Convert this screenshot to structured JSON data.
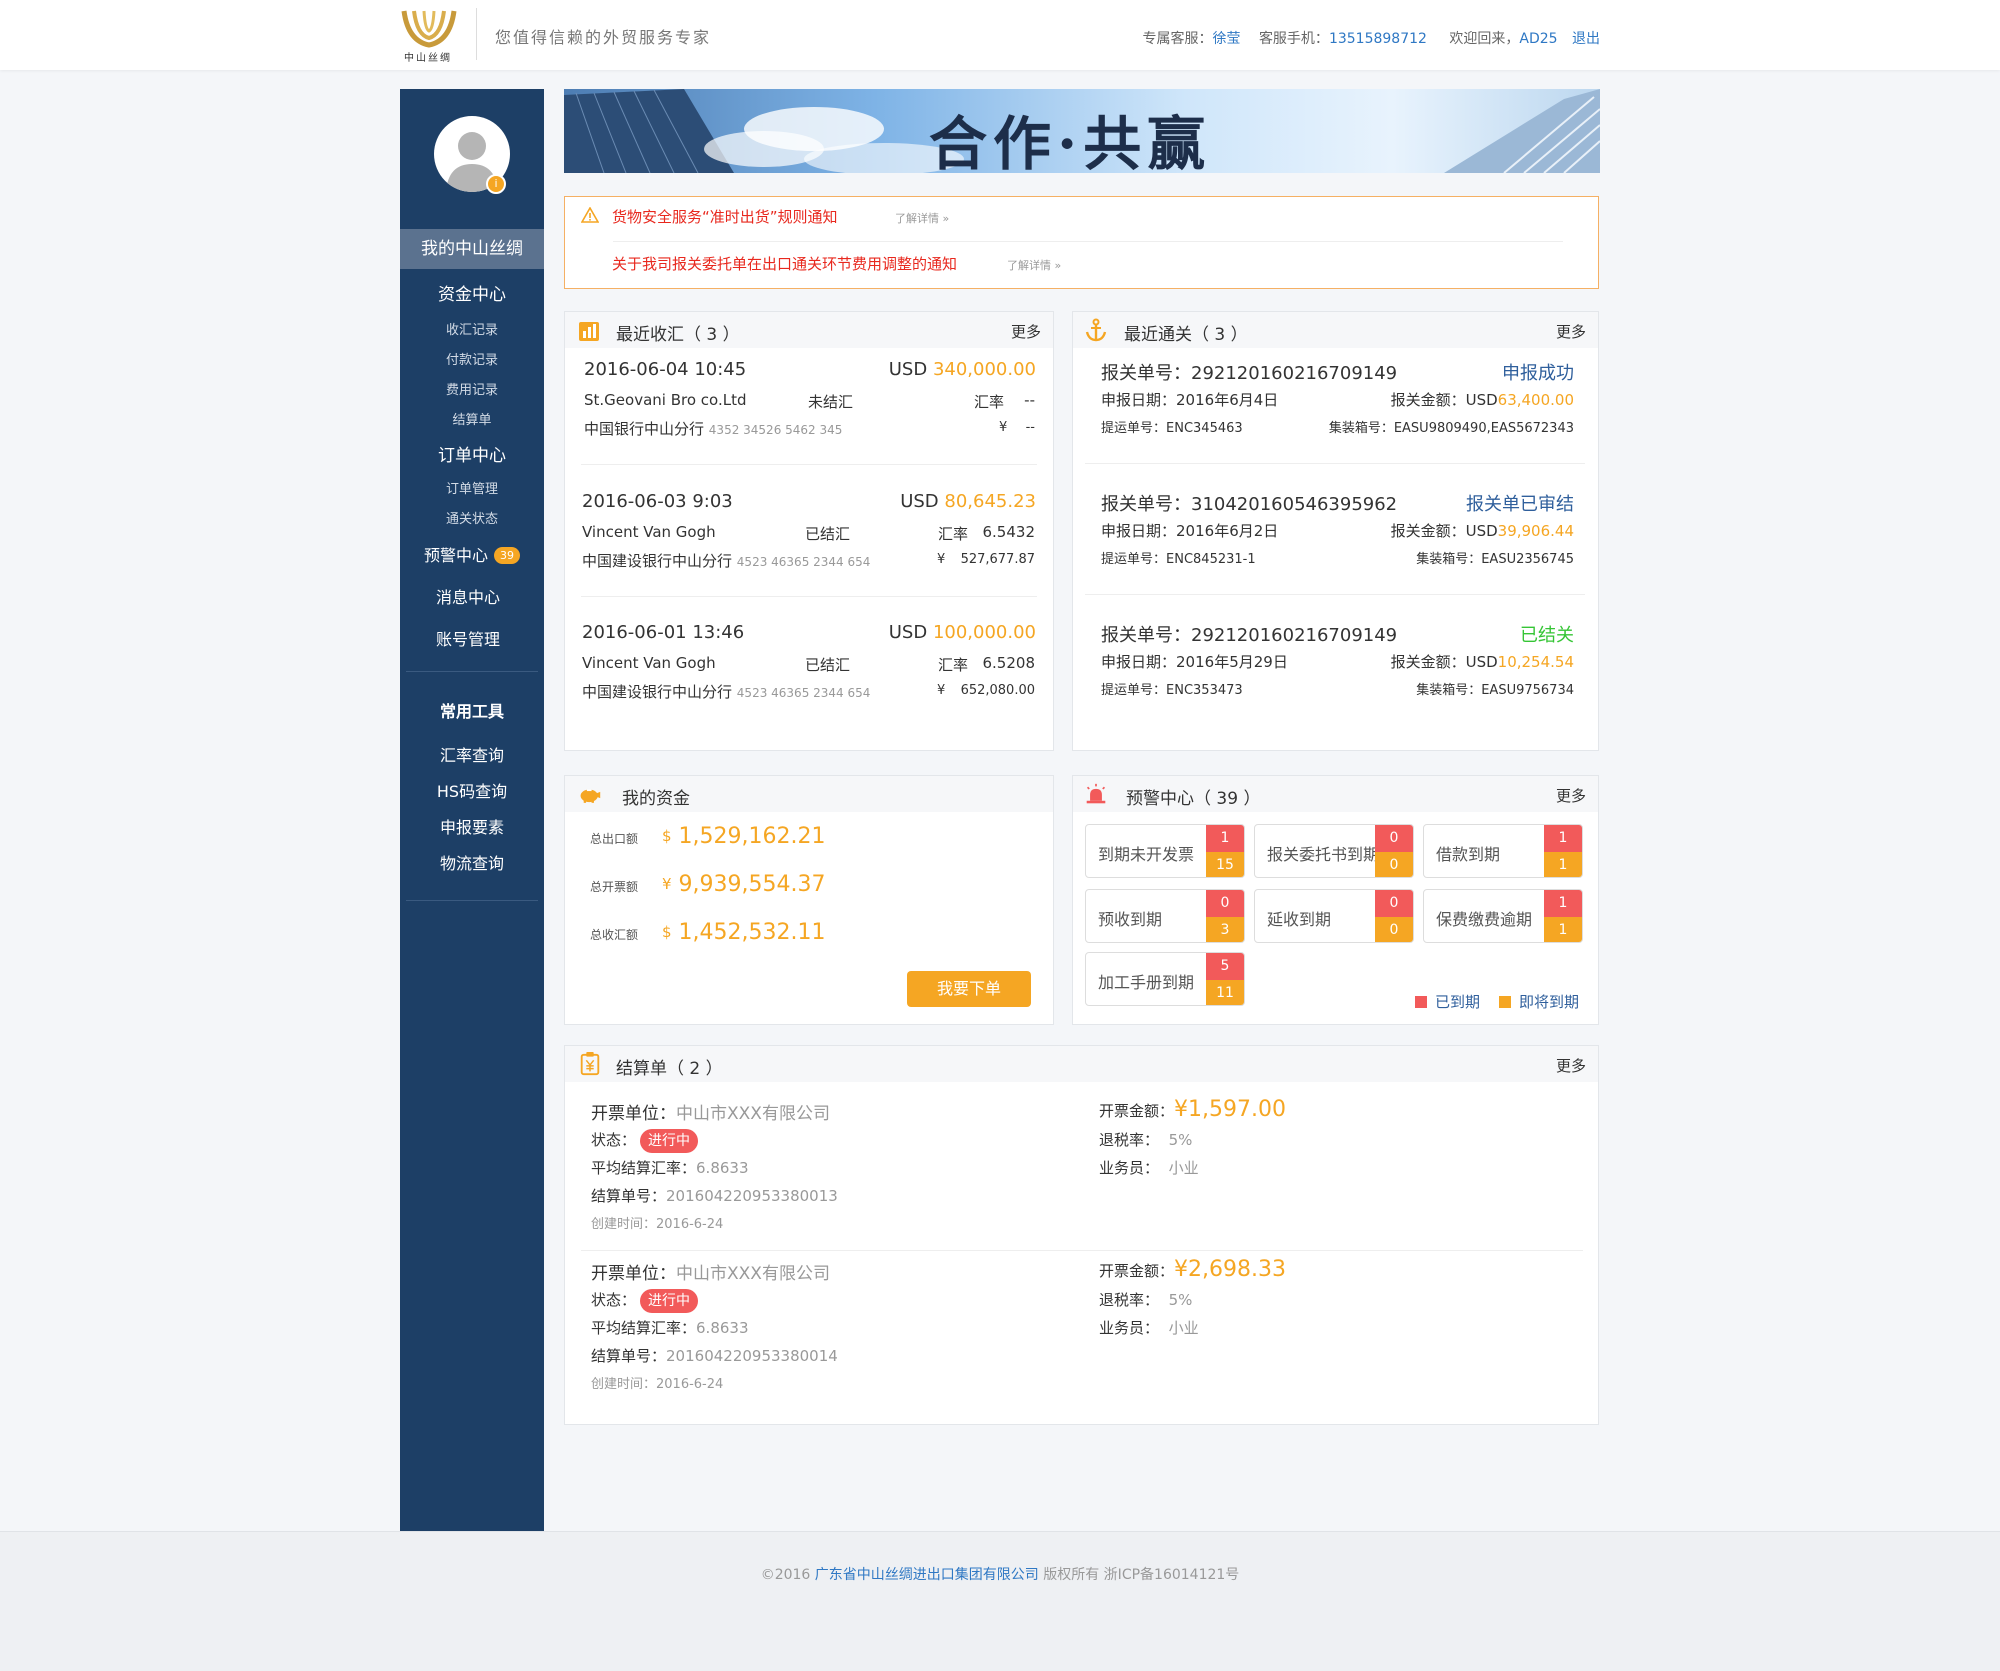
{
  "header": {
    "logo_text": "中山丝绸",
    "slogan": "您值得信赖的外贸服务专家",
    "service_label": "专属客服：",
    "service_name": "徐莹",
    "phone_label": "客服手机：",
    "phone": "13515898712",
    "welcome": "欢迎回来，",
    "username": "AD25",
    "logout": "退出"
  },
  "sidebar": {
    "items": [
      {
        "label": "我的中山丝绸"
      },
      {
        "label": "资金中心"
      },
      {
        "label": "收汇记录"
      },
      {
        "label": "付款记录"
      },
      {
        "label": "费用记录"
      },
      {
        "label": "结算单"
      },
      {
        "label": "订单中心"
      },
      {
        "label": "订单管理"
      },
      {
        "label": "通关状态"
      },
      {
        "label": "预警中心",
        "badge": "39"
      },
      {
        "label": "消息中心"
      },
      {
        "label": "账号管理"
      }
    ],
    "tools_title": "常用工具",
    "tools": [
      {
        "label": "汇率查询"
      },
      {
        "label": "HS码查询"
      },
      {
        "label": "申报要素"
      },
      {
        "label": "物流查询"
      }
    ]
  },
  "banner": {
    "title": "合作·共赢"
  },
  "notices": [
    {
      "text": "货物安全服务“准时出货”规则通知",
      "more": "了解详情  »"
    },
    {
      "text": "关于我司报关委托单在出口通关环节费用调整的通知",
      "more": "了解详情  »"
    }
  ],
  "receipts": {
    "title": "最近收汇（ 3 ）",
    "more": "更多",
    "items": [
      {
        "time": "2016-06-04 10:45",
        "currency": "USD",
        "amount": "340,000.00",
        "client": "St.Geovani Bro co.Ltd",
        "status": "未结汇",
        "rate_label": "汇率",
        "rate": "--",
        "bank": "中国银行中山分行",
        "account": "4352 34526 5462 345",
        "rmb_symbol": "¥",
        "rmb": "--"
      },
      {
        "time": "2016-06-03 9:03",
        "currency": "USD",
        "amount": "80,645.23",
        "client": "Vincent Van Gogh",
        "status": "已结汇",
        "rate_label": "汇率",
        "rate": "6.5432",
        "bank": "中国建设银行中山分行",
        "account": "4523 46365 2344 654",
        "rmb_symbol": "¥",
        "rmb": "527,677.87"
      },
      {
        "time": "2016-06-01 13:46",
        "currency": "USD",
        "amount": "100,000.00",
        "client": "Vincent Van Gogh",
        "status": "已结汇",
        "rate_label": "汇率",
        "rate": "6.5208",
        "bank": "中国建设银行中山分行",
        "account": "4523 46365 2344 654",
        "rmb_symbol": "¥",
        "rmb": "652,080.00"
      }
    ]
  },
  "customs": {
    "title": "最近通关（ 3 ）",
    "more": "更多",
    "items": [
      {
        "no_label": "报关单号：",
        "no": "292120160216709149",
        "status": "申报成功",
        "status_color": "#2f5f9c",
        "date_label": "申报日期：",
        "date": "2016年6月4日",
        "amt_label": "报关金额：USD",
        "amt": "63,400.00",
        "bl_label": "提运单号：",
        "bl": "ENC345463",
        "ctn_label": "集装箱号：",
        "ctn": "EASU9809490,EAS5672343"
      },
      {
        "no_label": "报关单号：",
        "no": "310420160546395962",
        "status": "报关单已审结",
        "status_color": "#2f5f9c",
        "date_label": "申报日期：",
        "date": "2016年6月2日",
        "amt_label": "报关金额：USD",
        "amt": "39,906.44",
        "bl_label": "提运单号：",
        "bl": "ENC845231-1",
        "ctn_label": "集装箱号：",
        "ctn": "EASU2356745"
      },
      {
        "no_label": "报关单号：",
        "no": "292120160216709149",
        "status": "已结关",
        "status_color": "#35c535",
        "date_label": "申报日期：",
        "date": "2016年5月29日",
        "amt_label": "报关金额：USD",
        "amt": "10,254.54",
        "bl_label": "提运单号：",
        "bl": "ENC353473",
        "ctn_label": "集装箱号：",
        "ctn": "EASU9756734"
      }
    ]
  },
  "funds": {
    "title": "我的资金",
    "rows": [
      {
        "label": "总出口额",
        "symbol": "$",
        "value": "1,529,162.21"
      },
      {
        "label": "总开票额",
        "symbol": "¥",
        "value": "9,939,554.37"
      },
      {
        "label": "总收汇额",
        "symbol": "$",
        "value": "1,452,532.11"
      }
    ],
    "button": "我要下单"
  },
  "alerts": {
    "title": "预警中心（ 39 ）",
    "more": "更多",
    "boxes": [
      {
        "label": "到期未开发票",
        "expired": "1",
        "soon": "15"
      },
      {
        "label": "报关委托书到期",
        "expired": "0",
        "soon": "0"
      },
      {
        "label": "借款到期",
        "expired": "1",
        "soon": "1"
      },
      {
        "label": "预收到期",
        "expired": "0",
        "soon": "3"
      },
      {
        "label": "延收到期",
        "expired": "0",
        "soon": "0"
      },
      {
        "label": "保费缴费逾期",
        "expired": "1",
        "soon": "1"
      },
      {
        "label": "加工手册到期",
        "expired": "5",
        "soon": "11"
      }
    ],
    "legend_expired": "已到期",
    "legend_soon": "即将到期",
    "colors": {
      "expired": "#f25a5a",
      "soon": "#f5a623"
    }
  },
  "settlements": {
    "title": "结算单（ 2 ）",
    "more": "更多",
    "items": [
      {
        "company_label": "开票单位：",
        "company": "中山市XXX有限公司",
        "status_label": "状态：",
        "status": "进行中",
        "avg_label": "平均结算汇率：",
        "avg": "6.8633",
        "no_label": "结算单号：",
        "no": "201604220953380013",
        "created": "创建时间：2016-6-24",
        "amt_label": "开票金额：",
        "amt": "¥1,597.00",
        "tax_label": "退税率：",
        "tax": "5%",
        "rep_label": "业务员：",
        "rep": "小业"
      },
      {
        "company_label": "开票单位：",
        "company": "中山市XXX有限公司",
        "status_label": "状态：",
        "status": "进行中",
        "avg_label": "平均结算汇率：",
        "avg": "6.8633",
        "no_label": "结算单号：",
        "no": "201604220953380014",
        "created": "创建时间：2016-6-24",
        "amt_label": "开票金额：",
        "amt": "¥2,698.33",
        "tax_label": "退税率：",
        "tax": "5%",
        "rep_label": "业务员：",
        "rep": "小业"
      }
    ]
  },
  "footer": {
    "prefix": "©2016",
    "company": "广东省中山丝绸进出口集团有限公司",
    "suffix": "版权所有 浙ICP备16014121号"
  },
  "colors": {
    "sidebar": "#1d3f66",
    "accent": "#f5a623",
    "link": "#2f78c4",
    "danger": "#f25a5a"
  }
}
